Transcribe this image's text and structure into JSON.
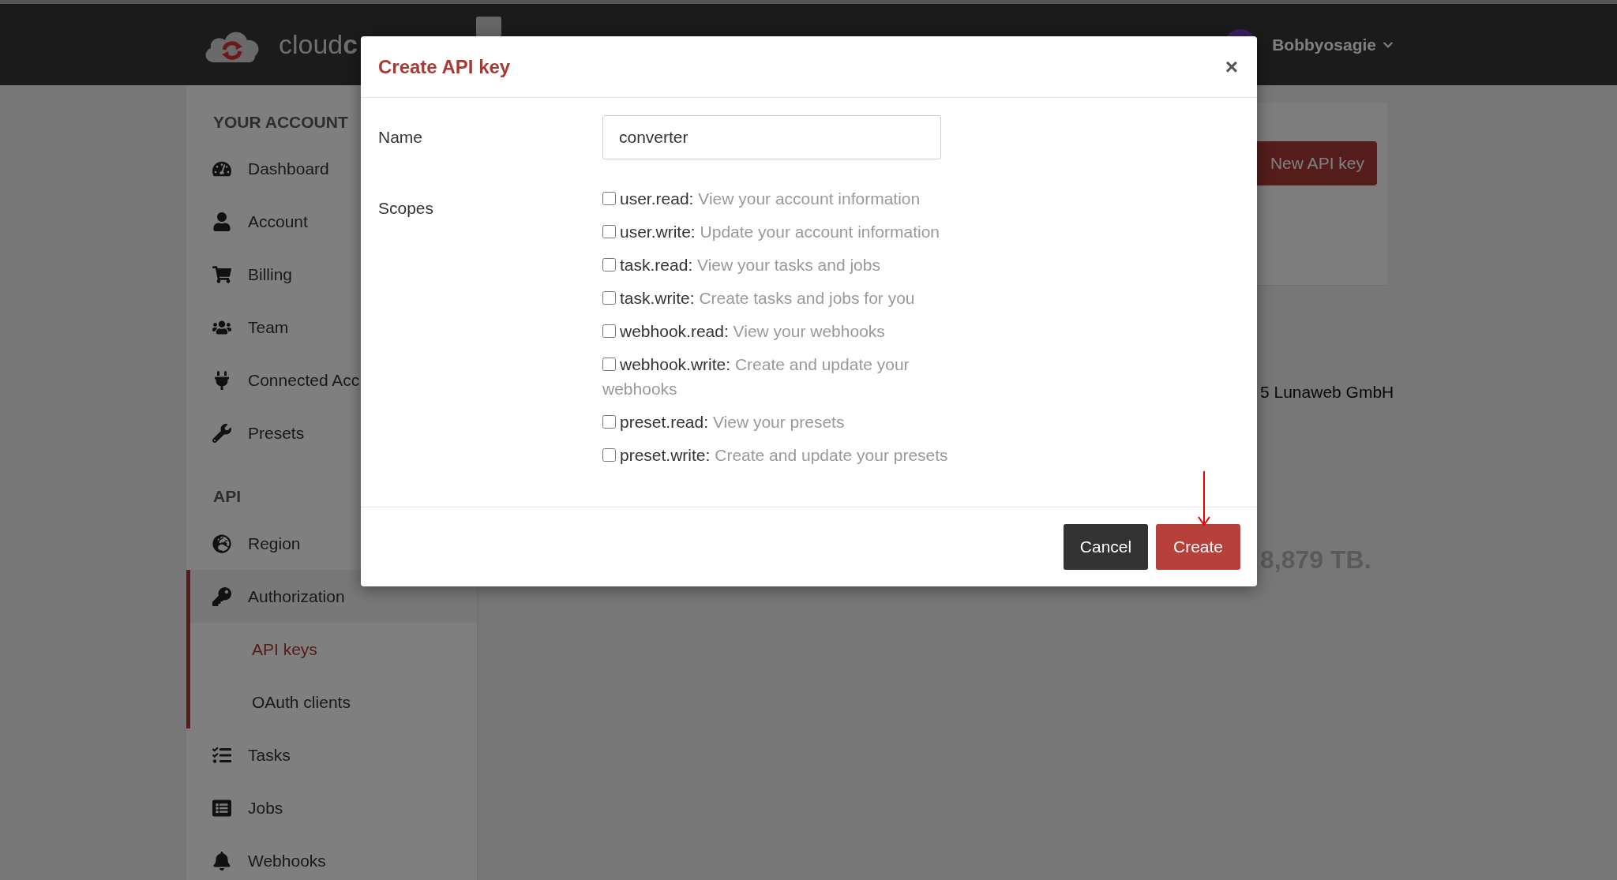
{
  "header": {
    "logo": "cloud**c**",
    "user": "Bobbyosagie"
  },
  "sidebar": {
    "sections": [
      {
        "title": "YOUR ACCOUNT",
        "items": [
          {
            "label": "Dashboard",
            "expanded": false
          },
          {
            "label": "Account",
            "expanded": false
          },
          {
            "label": "Billing",
            "expanded": false
          },
          {
            "label": "Team",
            "expanded": false
          },
          {
            "label": "Connected Acc",
            "expanded": false
          },
          {
            "label": "Presets",
            "expanded": false
          }
        ]
      },
      {
        "title": "API",
        "items": [
          {
            "label": "Region",
            "expanded": false
          },
          {
            "label": "Authorization",
            "expanded": true,
            "children": [
              {
                "label": "API keys",
                "selected": true
              },
              {
                "label": "OAuth clients",
                "selected": false
              }
            ]
          },
          {
            "label": "Tasks",
            "expanded": false
          },
          {
            "label": "Jobs",
            "expanded": false
          },
          {
            "label": "Webhooks",
            "expanded": false
          }
        ]
      }
    ]
  },
  "main": {
    "create_button": "New API key",
    "footer_text": "5 Lunaweb GmbH",
    "usage_text": "8,879 TB."
  },
  "modal": {
    "title": "Create API key",
    "close": "×",
    "name_label": "Name",
    "name_value": "converter",
    "scopes_label": "Scopes",
    "scopes": [
      {
        "name": "user.read:",
        "description": "View your account information",
        "checked": false
      },
      {
        "name": "user.write:",
        "description": "Update your account information",
        "checked": false
      },
      {
        "name": "task.read:",
        "description": "View your tasks and jobs",
        "checked": false
      },
      {
        "name": "task.write:",
        "description": "Create tasks and jobs for you",
        "checked": false
      },
      {
        "name": "webhook.read:",
        "description": "View your webhooks",
        "checked": false
      },
      {
        "name": "webhook.write:",
        "description": "Create and update your webhooks",
        "checked": false
      },
      {
        "name": "preset.read:",
        "description": "View your presets",
        "checked": false
      },
      {
        "name": "preset.write:",
        "description": "Create and update your presets",
        "checked": false
      }
    ],
    "buttons": [
      {
        "label": "Cancel",
        "kind": "secondary"
      },
      {
        "label": "Create",
        "kind": "primary"
      }
    ]
  }
}
